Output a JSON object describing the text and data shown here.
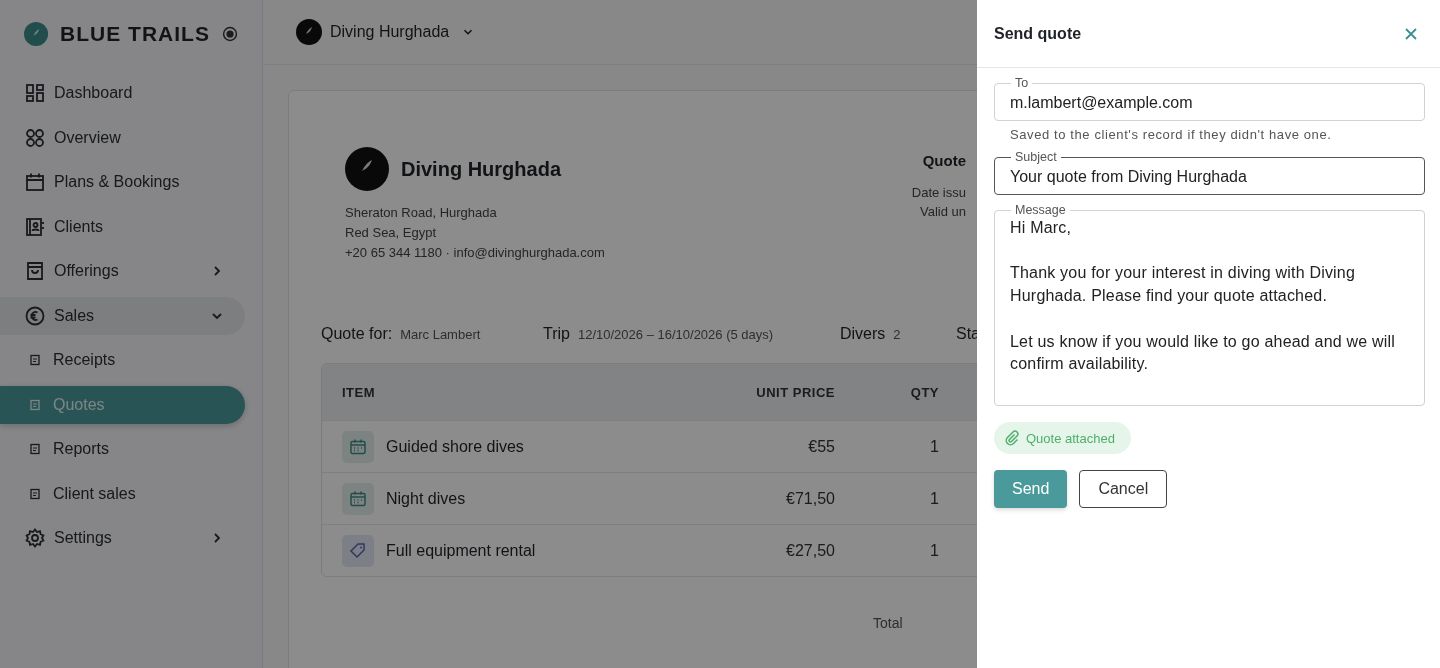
{
  "sidebar": {
    "brand": "BLUE TRAILS",
    "items": [
      {
        "label": "Dashboard",
        "kind": "dashboard",
        "selected": false
      },
      {
        "label": "Overview",
        "kind": "overview",
        "selected": false
      },
      {
        "label": "Plans & Bookings",
        "kind": "calendar",
        "selected": false
      },
      {
        "label": "Clients",
        "kind": "clients",
        "selected": false
      },
      {
        "label": "Offerings",
        "kind": "offerings",
        "selected": false,
        "expanded": false
      },
      {
        "label": "Sales",
        "kind": "sales",
        "selected": false,
        "expanded": true,
        "children": [
          {
            "label": "Receipts",
            "selected": false
          },
          {
            "label": "Quotes",
            "selected": true
          },
          {
            "label": "Reports",
            "selected": false
          },
          {
            "label": "Client sales",
            "selected": false
          }
        ]
      },
      {
        "label": "Settings",
        "kind": "settings",
        "selected": false,
        "expanded": false
      }
    ]
  },
  "workspace": {
    "name": "Diving Hurghada"
  },
  "quote": {
    "company": {
      "name": "Diving Hurghada",
      "address_lines": [
        "Sheraton Road, Hurghada",
        "Red Sea, Egypt",
        "+20 65 344 1180 · info@divinghurghada.com"
      ]
    },
    "meta": {
      "title": "Quote",
      "lines": [
        "Date issu",
        "Valid un"
      ]
    },
    "info": [
      {
        "label": "Quote for:",
        "value": "Marc Lambert"
      },
      {
        "label": "Trip",
        "value": "12/10/2026 – 16/10/2026 (5 days)"
      },
      {
        "label": "Divers",
        "value": "2"
      },
      {
        "label": "Sta"
      }
    ],
    "table": {
      "columns": [
        "ITEM",
        "UNIT PRICE",
        "QTY"
      ],
      "rows": [
        {
          "kind": "activity",
          "item": "Guided shore dives",
          "unit_price": "€55",
          "qty": "1"
        },
        {
          "kind": "activity",
          "item": "Night dives",
          "unit_price": "€71,50",
          "qty": "1"
        },
        {
          "kind": "rental",
          "item": "Full equipment rental",
          "unit_price": "€27,50",
          "qty": "1"
        }
      ]
    },
    "total_label": "Total"
  },
  "drawer": {
    "title": "Send quote",
    "to": {
      "label": "To",
      "value": "m.lambert@example.com",
      "hint": "Saved to the client's record if they didn't have one."
    },
    "subject": {
      "label": "Subject",
      "value": "Your quote from Diving Hurghada"
    },
    "message": {
      "label": "Message",
      "value": "Hi Marc,\n\nThank you for your interest in diving with Diving Hurghada. Please find your quote attached.\n\nLet us know if you would like to go ahead and we will confirm availability."
    },
    "attachment": "Quote attached",
    "buttons": [
      {
        "label": "Send",
        "kind": "primary"
      },
      {
        "label": "Cancel",
        "kind": "secondary"
      }
    ]
  }
}
